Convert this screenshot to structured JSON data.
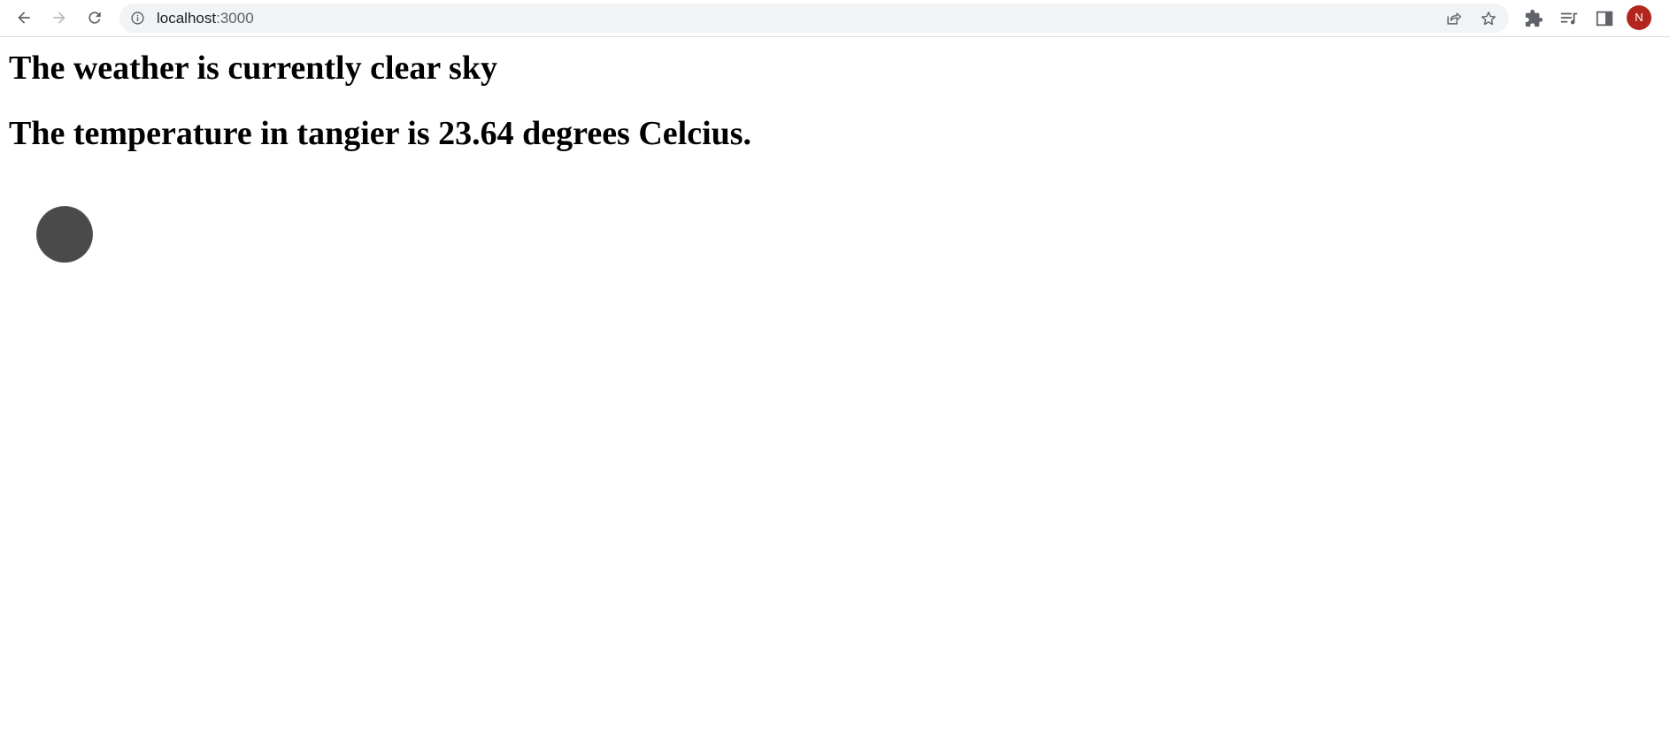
{
  "browser": {
    "url_host": "localhost",
    "url_port": ":3000",
    "profile_initial": "N",
    "icons": {
      "back": "back-arrow-icon",
      "forward": "forward-arrow-icon",
      "reload": "reload-icon",
      "site_info": "info-icon",
      "share": "share-icon",
      "bookmark": "star-icon",
      "extensions": "puzzle-icon",
      "media": "media-queue-icon",
      "side_panel": "side-panel-icon"
    },
    "colors": {
      "avatar": "#b3261e",
      "omnibox": "#f1f3f4"
    }
  },
  "page": {
    "weather_heading": "The weather is currently clear sky",
    "temperature_heading": "The temperature in tangier is 23.64 degrees Celcius.",
    "loader_color": "#4a4a4a"
  }
}
